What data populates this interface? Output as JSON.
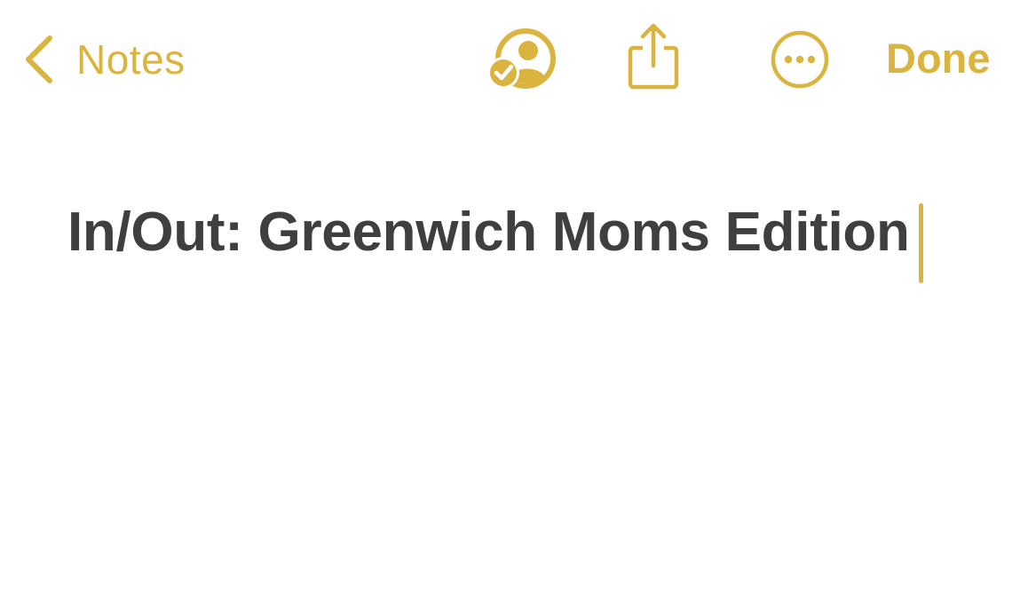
{
  "colors": {
    "accent": "#DBB33F",
    "title_text": "#3F3F40",
    "background": "#FFFFFF"
  },
  "toolbar": {
    "back_label": "Notes",
    "back_icon": "chevron-left-icon",
    "collaborate_icon": "person-checkmark-collaborate-icon",
    "share_icon": "share-icon",
    "more_icon": "ellipsis-circle-icon",
    "done_label": "Done"
  },
  "note": {
    "title": "In/Out: Greenwich Moms Edition"
  }
}
